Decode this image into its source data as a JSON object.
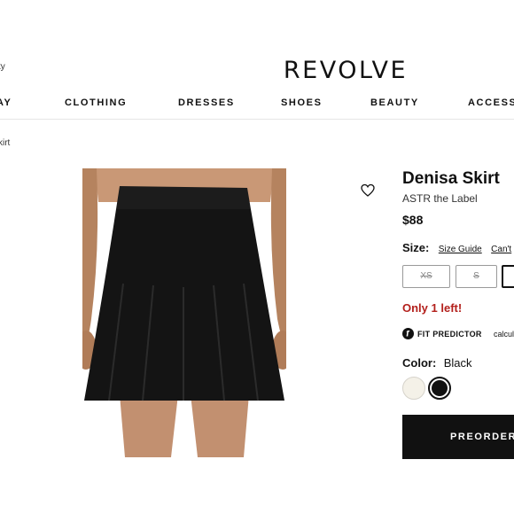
{
  "header": {
    "left_fragment": "ty",
    "logo": "REVOLVE"
  },
  "nav": {
    "items": [
      "AY",
      "CLOTHING",
      "DRESSES",
      "SHOES",
      "BEAUTY",
      "ACCESS"
    ]
  },
  "breadcrumb": {
    "fragment": "kirt"
  },
  "product": {
    "title": "Denisa Skirt",
    "brand": "ASTR the Label",
    "price": "$88",
    "size_label": "Size:",
    "size_guide": "Size Guide",
    "cant_find": "Can't",
    "sizes": [
      {
        "label": "XS",
        "available": false
      },
      {
        "label": "S",
        "available": false
      },
      {
        "label": "",
        "available": true
      }
    ],
    "stock_message": "Only 1 left!",
    "fit_predictor_label": "FIT PREDICTOR",
    "fit_predictor_text": "calculate",
    "color_label": "Color:",
    "color_value": "Black",
    "swatches": [
      {
        "name": "ivory",
        "hex": "#f4f1e8"
      },
      {
        "name": "black",
        "hex": "#111111"
      }
    ],
    "cta_label": "PREORDER"
  },
  "colors": {
    "accent": "#111111",
    "stock_red": "#b3201c",
    "divider": "#e6e6e6"
  }
}
